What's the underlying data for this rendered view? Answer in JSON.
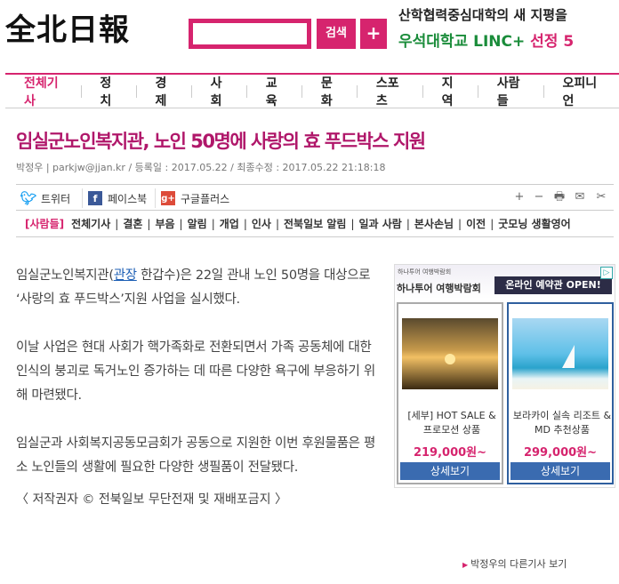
{
  "header": {
    "logo_text": "全北日報",
    "search_placeholder": "",
    "search_button": "검색",
    "plus_button": "+",
    "banner_line1": "산학협력중심대학의 새 지평을",
    "banner_university": "우석대학교",
    "banner_linc": "LINC+",
    "banner_selected": "선정 5"
  },
  "nav": {
    "items": [
      {
        "label": "전체기사",
        "active": true
      },
      {
        "label": "정치"
      },
      {
        "label": "경제"
      },
      {
        "label": "사회"
      },
      {
        "label": "교육"
      },
      {
        "label": "문화"
      },
      {
        "label": "스포츠"
      },
      {
        "label": "지역"
      },
      {
        "label": "사람들"
      },
      {
        "label": "오피니언"
      }
    ]
  },
  "article": {
    "title": "임실군노인복지관, 노인 50명에 사랑의 효 푸드박스 지원",
    "meta": "박정우 | parkjw@jjan.kr / 등록일 : 2017.05.22 / 최종수정 : 2017.05.22 21:18:18",
    "body_p1_before_link": "임실군노인복지관(",
    "body_p1_link": "관장",
    "body_p1_after_link": " 한갑수)은 22일 관내 노인 50명을 대상으로 ‘사랑의 효 푸드박스’지원 사업을 실시했다.",
    "body_p2": "이날 사업은 현대 사회가 핵가족화로 전환되면서 가족 공동체에 대한 인식의 붕괴로 독거노인 증가하는 데 따른 다양한 욕구에 부응하기 위해 마련됐다.",
    "body_p3": "임실군과 사회복지공동모금회가 공동으로 지원한 이번 후원물품은 평소 노인들의 생활에 필요한 다양한 생필품이 전달됐다.",
    "copyright": "〈 저작권자 © 전북일보 무단전재 및 재배포금지 〉",
    "more_by_author": "박정우의 다른기사 보기"
  },
  "share": {
    "twitter": "트위터",
    "facebook": "페이스북",
    "google": "구글플러스",
    "tools": [
      "+",
      "−",
      "🖶",
      "✉",
      "✂"
    ]
  },
  "tags": {
    "label": "[사람들]",
    "items": [
      "전체기사",
      "결혼",
      "부음",
      "알림",
      "개업",
      "인사",
      "전북일보 알림",
      "일과 사람",
      "본사손님",
      "이전",
      "굿모닝 생활영어"
    ]
  },
  "ad": {
    "brand_small": "하나투어 여행박람회",
    "brand": "하나투어 여행박람회",
    "open_text": "온라인 예약관 OPEN!",
    "choice": "▷",
    "cards": [
      {
        "text": "[세부] HOT SALE & 프로모션 상품",
        "price": "219,000원~",
        "cta": "상세보기"
      },
      {
        "text": "보라카이 실속 리조트 & MD 추천상품",
        "price": "299,000원~",
        "cta": "상세보기"
      }
    ]
  },
  "colors": {
    "accent": "#d6246e",
    "title": "#b0176a",
    "link": "#1d5fb5",
    "cta": "#3a6bb0"
  }
}
